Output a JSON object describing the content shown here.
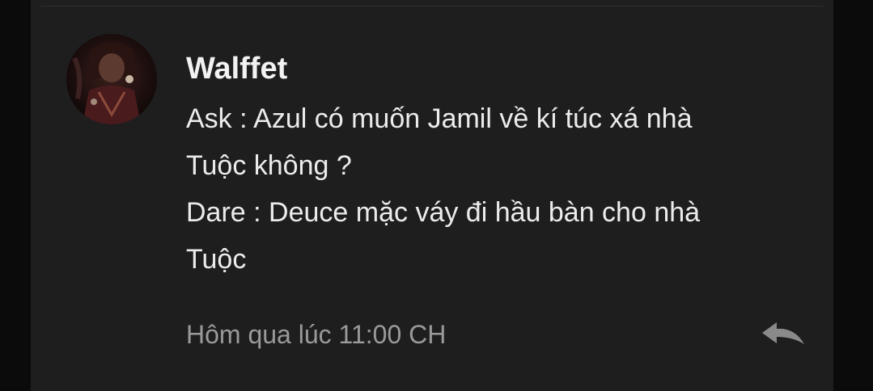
{
  "comment": {
    "author": "Walffet",
    "lines": [
      "Ask : Azul có muốn Jamil về kí túc xá nhà",
      "Tuộc không ?",
      "Dare : Deuce mặc váy đi hầu bàn cho nhà",
      "Tuộc"
    ],
    "timestamp": "Hôm qua lúc 11:00 CH",
    "reply_icon": "reply-arrow-icon",
    "avatar": "user-avatar"
  },
  "colors": {
    "background": "#0b0b0b",
    "card": "#1e1e1e",
    "text": "#ececec",
    "muted": "#9a9a9a"
  }
}
